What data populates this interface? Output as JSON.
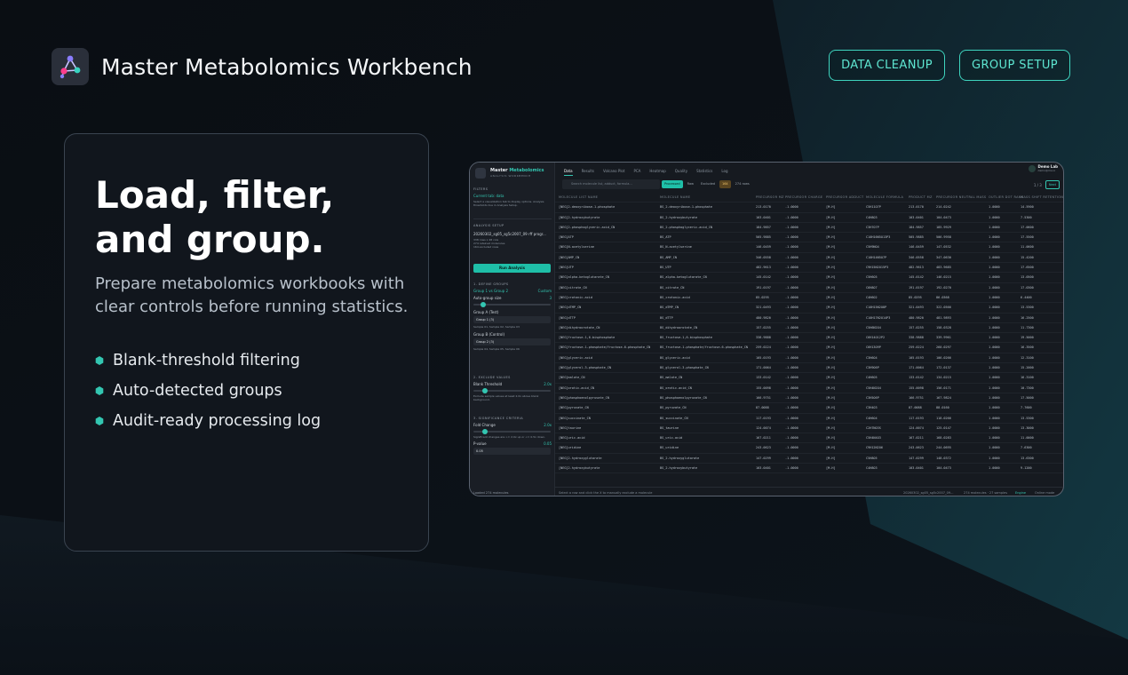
{
  "app": {
    "title": "Master Metabolomics Workbench"
  },
  "nav": {
    "data_cleanup": "DATA CLEANUP",
    "group_setup": "GROUP SETUP"
  },
  "hero": {
    "headline": "Load, filter, and group.",
    "subhead": "Prepare metabolomics workbooks with clear controls before running statistics.",
    "bullets": [
      "Blank-threshold filtering",
      "Auto-detected groups",
      "Audit-ready processing log"
    ]
  },
  "colors": {
    "accent": "#33c6b1",
    "background": "#0b1016",
    "card": "#11161d"
  },
  "preview": {
    "brand": "Master",
    "brand_accent": "Metabolomics",
    "brand_sub": "ANALYSIS WORKBENCH",
    "sidebar": {
      "filters": "FILTERS",
      "current_tab": "Current tab: data",
      "filters_help": "Select a visualization tab to display options. Analysis thresholds live in Analysis Setup.",
      "analysis_setup": "ANALYSIS SETUP",
      "file": "20260302_sg05_sg5c2007_09 rff progr...",
      "file_meta": [
        "338 rows x 48 cols",
        "274 retained molecules",
        "164 excluded rows"
      ],
      "run": "Run Analysis",
      "define_groups": "1. DEFINE GROUPS",
      "groups_link": "Group 1 vs Group 2",
      "custom": "Custom",
      "auto_size": "Auto-group size",
      "auto_size_val": "3",
      "group_a": "Group A (Test)",
      "group_a_val": "Group 1 (3)",
      "group_a_samples": "Sample 01, Sample 02, Sample 03",
      "group_b": "Group B (Control)",
      "group_b_val": "Group 2 (3)",
      "group_b_samples": "Sample 04, Sample 05, Sample 06",
      "exclude": "2. EXCLUDE VALUES",
      "blank": "Blank Threshold",
      "blank_val": "2.0x",
      "blank_help": "Exclude sample values at least 2.0x above blank background.",
      "significance": "3. SIGNIFICANCE CRITERIA",
      "fold": "Fold Change",
      "fold_val": "2.0x",
      "fold_help": "Significant changes are >= 2.0x up or <= 0.5x down.",
      "pvalue": "P-value",
      "pvalue_val": "0.05",
      "pvalue_select": "0.05"
    },
    "tabs": [
      "Data",
      "Results",
      "Volcano Plot",
      "PCA",
      "Heatmap",
      "Quality",
      "Statistics",
      "Log"
    ],
    "user_name": "Demo Lab",
    "user_sub": "demo@ms.io",
    "search_placeholder": "Search molecule list, adduct, formula...",
    "segments": [
      "Processed",
      "Raw",
      "Excluded"
    ],
    "excluded_count": "164",
    "row_count": "274 rows",
    "pager": "1 / 3",
    "next": "Next",
    "columns": [
      "MOLECULE LIST NAME",
      "MOLECULE NAME",
      "PRECURSOR MZ",
      "PRECURSOR CHARGE",
      "PRECURSOR ADDUCT",
      "MOLECULE FORMULA",
      "PRODUCT MZ",
      "PRECURSOR NEUTRAL MASS",
      "OUTLIER DOT RANK",
      "MASS SHIFT RETENTION"
    ],
    "rows": [
      [
        "[NEG]2-deoxyribose-1-phosphate",
        "BS_2-deoxyribose-1-phosphate",
        "213.0170",
        "-1.0000",
        "[M-H]",
        "C5H11O7P",
        "213.0170",
        "214.0242",
        "1.0000",
        "14.5900"
      ],
      [
        "[NEG]2-hydroxybutyrate",
        "BS_2-hydroxybutyrate",
        "103.0401",
        "-1.0000",
        "[M-H]",
        "C4H8O3",
        "103.0401",
        "104.0473",
        "1.0000",
        "7.5300"
      ],
      [
        "[NEG]2-phosphoglyceric-acid_CN",
        "BS_2-phosphoglyceric-acid_CN",
        "184.9857",
        "-1.0000",
        "[M-H]",
        "C3H7O7P",
        "184.9857",
        "185.9929",
        "1.0000",
        "17.0600"
      ],
      [
        "[NEG]ATP",
        "BS_ATP",
        "505.9885",
        "-1.0000",
        "[M-H]",
        "C10H16N5O13P3",
        "505.9885",
        "506.9958",
        "1.0000",
        "17.5500"
      ],
      [
        "[NEG]N-acetylserine",
        "BS_N-acetylserine",
        "146.0459",
        "-1.0000",
        "[M-H]",
        "C5H9NO4",
        "146.0459",
        "147.0532",
        "1.0000",
        "11.0600"
      ],
      [
        "[NEG]AMP_CN",
        "BS_AMP_CN",
        "346.0558",
        "-1.0000",
        "[M-H]",
        "C10H14N5O7P",
        "346.0558",
        "347.0630",
        "1.0000",
        "15.4200"
      ],
      [
        "[NEG]UTP",
        "BS_UTP",
        "482.9613",
        "-1.0000",
        "[M-H]",
        "C9H15N2O15P3",
        "482.9613",
        "483.9685",
        "1.0000",
        "17.6500"
      ],
      [
        "[NEG]alpha-ketoglutarate_CN",
        "BS_alpha-ketoglutarate_CN",
        "145.0142",
        "-1.0000",
        "[M-H]",
        "C5H6O5",
        "145.0142",
        "146.0215",
        "1.0000",
        "13.0500"
      ],
      [
        "[NEG]citrate_CN",
        "BS_citrate_CN",
        "191.0197",
        "-1.0000",
        "[M-H]",
        "C6H8O7",
        "191.0197",
        "192.0270",
        "1.0000",
        "17.0300"
      ],
      [
        "[NEG]crotonic-acid",
        "BS_crotonic-acid",
        "85.0295",
        "-1.0000",
        "[M-H]",
        "C4H6O2",
        "85.0295",
        "86.0368",
        "1.0000",
        "6.4400"
      ],
      [
        "[NEG]dTMP_CN",
        "BS_dTMP_CN",
        "321.0493",
        "-1.0000",
        "[M-H]",
        "C10H15N2O8P",
        "321.0493",
        "322.0566",
        "1.0000",
        "13.5300"
      ],
      [
        "[NEG]dTTP",
        "BS_dTTP",
        "480.9820",
        "-1.0000",
        "[M-H]",
        "C10H17N2O14P3",
        "480.9820",
        "481.9893",
        "1.0000",
        "16.2500"
      ],
      [
        "[NEG]dihydroorotate_CN",
        "BS_dihydroorotate_CN",
        "157.0255",
        "-1.0000",
        "[M-H]",
        "C5H6N2O4",
        "157.0255",
        "158.0328",
        "1.0000",
        "11.7300"
      ],
      [
        "[NEG]fructose-1,6-bisphosphate",
        "BS_fructose-1,6-bisphosphate",
        "338.9888",
        "-1.0000",
        "[M-H]",
        "C6H14O12P2",
        "338.9888",
        "339.9961",
        "1.0000",
        "19.5000"
      ],
      [
        "[NEG]fructose-1-phosphate/fructose-6-phosphate_CN",
        "BS_fructose-1-phosphate/fructose-6-phosphate_CN",
        "259.0224",
        "-1.0000",
        "[M-H]",
        "C6H13O9P",
        "259.0224",
        "260.0297",
        "1.0000",
        "16.3500"
      ],
      [
        "[NEG]glyceric-acid",
        "BS_glyceric-acid",
        "105.0193",
        "-1.0000",
        "[M-H]",
        "C3H6O4",
        "105.0193",
        "106.0266",
        "1.0000",
        "12.3100"
      ],
      [
        "[NEG]glycerol-3-phosphate_CN",
        "BS_glycerol-3-phosphate_CN",
        "171.0064",
        "-1.0000",
        "[M-H]",
        "C3H9O6P",
        "171.0064",
        "172.0137",
        "1.0000",
        "15.2000"
      ],
      [
        "[NEG]malate_CN",
        "BS_malate_CN",
        "133.0142",
        "-1.0000",
        "[M-H]",
        "C4H6O5",
        "133.0142",
        "134.0215",
        "1.0000",
        "16.3100"
      ],
      [
        "[NEG]orotic-acid_CN",
        "BS_orotic-acid_CN",
        "155.0098",
        "-1.0000",
        "[M-H]",
        "C5H4N2O4",
        "155.0098",
        "156.0171",
        "1.0000",
        "10.7300"
      ],
      [
        "[NEG]phosphoenolpyruvate_CN",
        "BS_phosphoenolpyruvate_CN",
        "166.9751",
        "-1.0000",
        "[M-H]",
        "C3H5O6P",
        "166.9751",
        "167.9824",
        "1.0000",
        "17.5000"
      ],
      [
        "[NEG]pyruvate_CN",
        "BS_pyruvate_CN",
        "87.0088",
        "-1.0000",
        "[M-H]",
        "C3H4O3",
        "87.0088",
        "88.0160",
        "1.0000",
        "7.7600"
      ],
      [
        "[NEG]succinate_CN",
        "BS_succinate_CN",
        "117.0193",
        "-1.0000",
        "[M-H]",
        "C4H6O4",
        "117.0193",
        "118.0266",
        "1.0000",
        "13.5300"
      ],
      [
        "[NEG]taurine",
        "BS_taurine",
        "124.0074",
        "-1.0000",
        "[M-H]",
        "C2H7NO3S",
        "124.0074",
        "125.0147",
        "1.0000",
        "13.3000"
      ],
      [
        "[NEG]uric-acid",
        "BS_uric-acid",
        "167.0211",
        "-1.0000",
        "[M-H]",
        "C5H4N4O3",
        "167.0211",
        "168.0283",
        "1.0000",
        "11.0000"
      ],
      [
        "[NEG]uridine",
        "BS_uridine",
        "243.0623",
        "-1.0000",
        "[M-H]",
        "C9H12N2O6",
        "243.0623",
        "244.0695",
        "1.0000",
        "7.6300"
      ],
      [
        "[NEG]2-hydroxyglutarate",
        "BS_2-hydroxyglutarate",
        "147.0299",
        "-1.0000",
        "[M-H]",
        "C5H8O5",
        "147.0299",
        "148.0372",
        "1.0000",
        "13.6300"
      ],
      [
        "[NEG]2-hydroxybutyrate",
        "BS_2-hydroxybutyrate",
        "103.0401",
        "-1.0000",
        "[M-H]",
        "C4H8O3",
        "103.0401",
        "104.0473",
        "1.0000",
        "9.1200"
      ]
    ],
    "footer_left": "Loaded 274 molecules",
    "footer_hint": "Select a row and click the X to manually exclude a molecule",
    "footer_file": "20260302_sg05_sg5c2007_09...",
    "footer_count": "274 molecules · 27 samples",
    "footer_engine": "Engine",
    "footer_status": "Online mode"
  }
}
